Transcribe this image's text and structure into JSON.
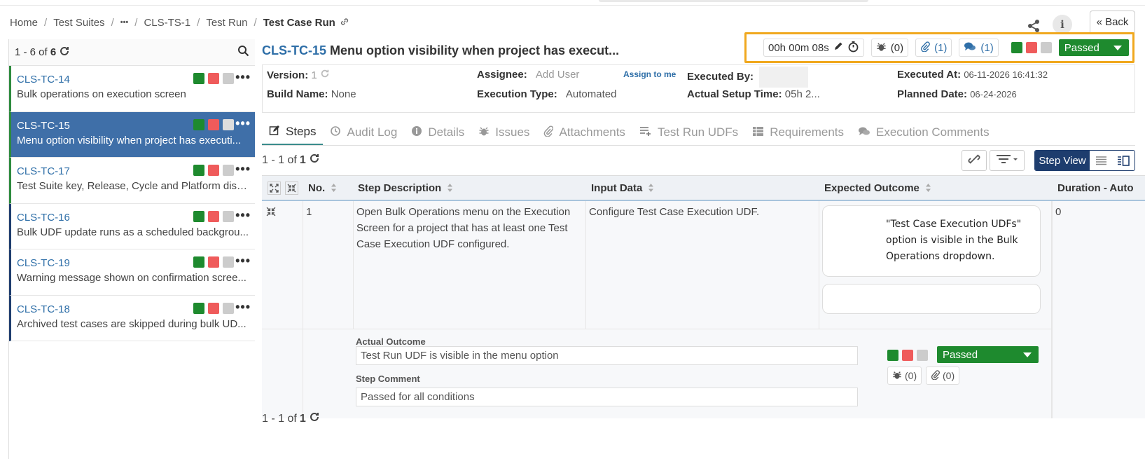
{
  "breadcrumb": {
    "items": [
      "Home",
      "Test Suites",
      "•••",
      "CLS-TS-1",
      "Test Run"
    ],
    "current": "Test Case Run",
    "separator": "/"
  },
  "header": {
    "back_label": "Back",
    "info_label": "i",
    "back_icon": "«"
  },
  "sidebar": {
    "range": "1 - 6 of",
    "total": "6",
    "items": [
      {
        "key": "CLS-TC-14",
        "title": "Bulk operations on execution screen",
        "active": false
      },
      {
        "key": "CLS-TC-15",
        "title": "Menu option visibility when project has executi...",
        "active": true
      },
      {
        "key": "CLS-TC-17",
        "title": "Test Suite key, Release, Cycle and Platform displ...",
        "active": false
      },
      {
        "key": "CLS-TC-16",
        "title": "Bulk UDF update runs as a scheduled backgrou...",
        "active": false
      },
      {
        "key": "CLS-TC-19",
        "title": "Warning message shown on confirmation scree...",
        "active": false
      },
      {
        "key": "CLS-TC-18",
        "title": "Archived test cases are skipped during bulk UD...",
        "active": false
      }
    ],
    "more_label": "•••"
  },
  "main": {
    "key": "CLS-TC-15",
    "title": "Menu option visibility when project has execut...",
    "actions": {
      "timer": "00h 00m 08s",
      "issues": "(0)",
      "attachments": "(1)",
      "comments": "(1)",
      "status": "Passed"
    },
    "info": {
      "version_label": "Version:",
      "version_value": "1",
      "build_label": "Build Name:",
      "build_value": "None",
      "assignee_label": "Assignee:",
      "assignee_value": "Add User",
      "assign_me": "Assign to me",
      "exec_type_label": "Execution Type:",
      "exec_type_value": "Automated",
      "executed_by_label": "Executed By:",
      "setup_label": "Actual Setup Time:",
      "setup_value": "05h 2...",
      "executed_at_label": "Executed At:",
      "executed_at_value": "06-11-2026 16:41:32",
      "planned_label": "Planned Date:",
      "planned_value": "06-24-2026"
    },
    "tabs": [
      "Steps",
      "Audit Log",
      "Details",
      "Issues",
      "Attachments",
      "Test Run UDFs",
      "Requirements",
      "Execution Comments"
    ],
    "pager": {
      "range": "1 - 1 of",
      "total": "1"
    },
    "step_view_label": "Step View",
    "table": {
      "columns": [
        "No.",
        "Step Description",
        "Input Data",
        "Expected Outcome",
        "Duration - Auto"
      ],
      "rows": [
        {
          "no": "1",
          "description": "Open Bulk Operations menu on the Execution Screen for a project that has at least one Test Case Execution UDF configured.",
          "input": "Configure Test Case Execution UDF.",
          "expected": "\"Test Case Execution UDFs\" option is visible in the Bulk Operations dropdown.",
          "duration": "0",
          "actual_label": "Actual Outcome",
          "actual_value": "Test Run UDF is visible in the menu option",
          "comment_label": "Step Comment",
          "comment_value": "Passed for all conditions",
          "status": "Passed",
          "issues": "(0)",
          "attachments": "(0)"
        }
      ]
    }
  },
  "colors": {
    "pass": "#1e8a2e",
    "fail": "#ef5b5b",
    "notrun": "#cccccc",
    "accent": "#2f6fa8",
    "highlight": "#f0a81e",
    "navy": "#1e3d6e"
  }
}
